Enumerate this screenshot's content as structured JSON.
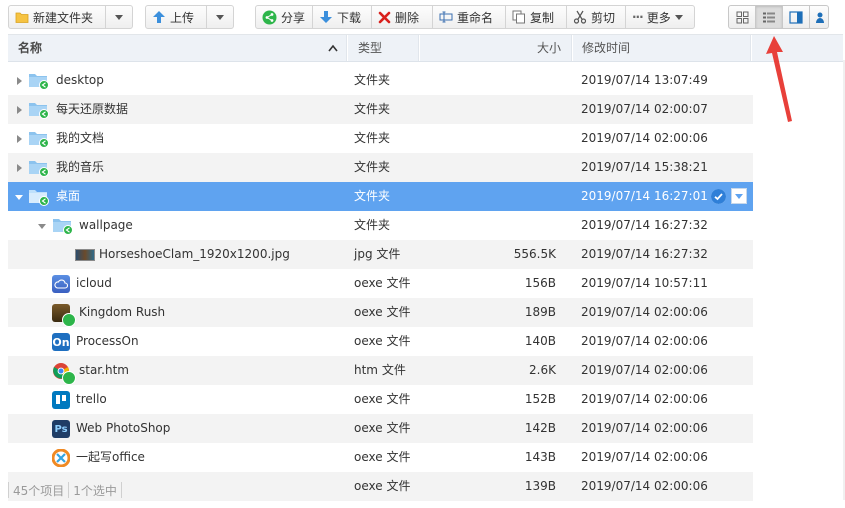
{
  "toolbar": {
    "new_folder": "新建文件夹",
    "upload": "上传",
    "share": "分享",
    "download": "下载",
    "delete": "删除",
    "rename": "重命名",
    "copy": "复制",
    "cut": "剪切",
    "more": "更多"
  },
  "header": {
    "name": "名称",
    "type": "类型",
    "size": "大小",
    "modified": "修改时间"
  },
  "rows": [
    {
      "name": "desktop",
      "type": "文件夹",
      "size": "",
      "modified": "2019/07/14 13:07:49"
    },
    {
      "name": "每天还原数据",
      "type": "文件夹",
      "size": "",
      "modified": "2019/07/14 02:00:07"
    },
    {
      "name": "我的文档",
      "type": "文件夹",
      "size": "",
      "modified": "2019/07/14 02:00:06"
    },
    {
      "name": "我的音乐",
      "type": "文件夹",
      "size": "",
      "modified": "2019/07/14 15:38:21"
    },
    {
      "name": "桌面",
      "type": "文件夹",
      "size": "",
      "modified": "2019/07/14 16:27:01"
    },
    {
      "name": "wallpage",
      "type": "文件夹",
      "size": "",
      "modified": "2019/07/14 16:27:32"
    },
    {
      "name": "HorseshoeClam_1920x1200.jpg",
      "type": "jpg 文件",
      "size": "556.5K",
      "modified": "2019/07/14 16:27:32"
    },
    {
      "name": "icloud",
      "type": "oexe 文件",
      "size": "156B",
      "modified": "2019/07/14 10:57:11"
    },
    {
      "name": "Kingdom Rush",
      "type": "oexe 文件",
      "size": "189B",
      "modified": "2019/07/14 02:00:06"
    },
    {
      "name": "ProcessOn",
      "type": "oexe 文件",
      "size": "140B",
      "modified": "2019/07/14 02:00:06"
    },
    {
      "name": "star.htm",
      "type": "htm 文件",
      "size": "2.6K",
      "modified": "2019/07/14 02:00:06"
    },
    {
      "name": "trello",
      "type": "oexe 文件",
      "size": "152B",
      "modified": "2019/07/14 02:00:06"
    },
    {
      "name": "Web PhotoShop",
      "type": "oexe 文件",
      "size": "142B",
      "modified": "2019/07/14 02:00:06"
    },
    {
      "name": "一起写office",
      "type": "oexe 文件",
      "size": "143B",
      "modified": "2019/07/14 02:00:06"
    },
    {
      "name": "",
      "type": "oexe 文件",
      "size": "139B",
      "modified": "2019/07/14 02:00:06"
    }
  ],
  "status": {
    "items": "45个项目",
    "selected": "1个选中"
  },
  "colors": {
    "selection": "#5fa3f0",
    "share_badge": "#2db54a",
    "folder": "#8cc3ee",
    "annotation": "#e8403a"
  }
}
